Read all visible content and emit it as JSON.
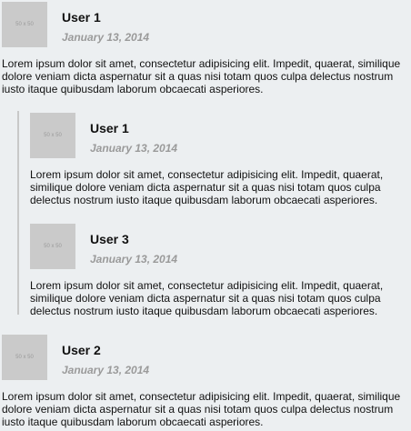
{
  "avatar_label": "50 x 50",
  "comments": [
    {
      "user": "User 1",
      "date": "January 13, 2014",
      "text": "Lorem ipsum dolor sit amet, consectetur adipisicing elit. Impedit, quaerat, similique dolore veniam dicta aspernatur sit a quas nisi totam quos culpa delectus nostrum iusto itaque quibusdam laborum obcaecati asperiores."
    },
    {
      "user": "User 1",
      "date": "January 13, 2014",
      "text": "Lorem ipsum dolor sit amet, consectetur adipisicing elit. Impedit, quaerat, similique dolore veniam dicta aspernatur sit a quas nisi totam quos culpa delectus nostrum iusto itaque quibusdam laborum obcaecati asperiores."
    },
    {
      "user": "User 3",
      "date": "January 13, 2014",
      "text": "Lorem ipsum dolor sit amet, consectetur adipisicing elit. Impedit, quaerat, similique dolore veniam dicta aspernatur sit a quas nisi totam quos culpa delectus nostrum iusto itaque quibusdam laborum obcaecati asperiores."
    },
    {
      "user": "User 2",
      "date": "January 13, 2014",
      "text": "Lorem ipsum dolor sit amet, consectetur adipisicing elit. Impedit, quaerat, similique dolore veniam dicta aspernatur sit a quas nisi totam quos culpa delectus nostrum iusto itaque quibusdam laborum obcaecati asperiores."
    }
  ]
}
